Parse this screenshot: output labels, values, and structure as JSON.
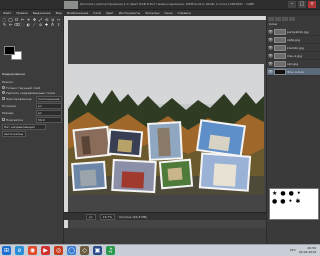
{
  "window": {
    "title": "[Коллаж] (импортирована)-1.0 (Цвет RGB 8 бит гамма-коррекция, GIMP built-in sRGB, 4 слоя) 1280x847 – GIMP",
    "buttons": [
      "–",
      "□",
      "×"
    ]
  },
  "menu": [
    "Файл",
    "Правка",
    "Выделение",
    "Вид",
    "Изображение",
    "Слой",
    "Цвет",
    "Инструменты",
    "Фильтры",
    "Окна",
    "Справка"
  ],
  "toolbox": {
    "tool_glyphs": [
      "⬚",
      "◯",
      "ⵔ",
      "✂",
      "⌖",
      "✥",
      "⤢",
      "⟲",
      "⇲",
      "⇿",
      "✎",
      "✏",
      "⌫",
      "⬛",
      "◐",
      "☄",
      "⊘",
      "✚",
      "A",
      "⇧"
    ],
    "options_title": "Кадрирование",
    "mode_label": "Режим:",
    "radio": [
      "Только текущий слой",
      "Удалить кадрированные точки"
    ],
    "fixed_label": "Фиксированные",
    "fixed_value": "Соотношение",
    "fields": [
      {
        "label": "Позиция:",
        "value": "px"
      },
      {
        "label": "Размер:",
        "value": "px"
      }
    ],
    "highlight_label": "Подсветка",
    "highlight_value": "50.0",
    "guides_label": "Нет направляющих",
    "autoshrink_label": "Автосжатие"
  },
  "canvas": {
    "zoom": "px",
    "zoom_pct": "16.7%",
    "status": "Коллаж (64.8 МБ)"
  },
  "dock": {
    "panel_title": "Слои",
    "layers": [
      {
        "name": "pamyatnik.jpg",
        "visible": true,
        "active": false
      },
      {
        "name": "хрбр.jpg",
        "visible": true,
        "active": false
      },
      {
        "name": "kremlin.jpg",
        "visible": true,
        "active": false
      },
      {
        "name": "msu-1.jpg",
        "visible": true,
        "active": false
      },
      {
        "name": "хрп.jpg",
        "visible": true,
        "active": false
      },
      {
        "name": "Фон копия",
        "visible": true,
        "active": true
      }
    ],
    "eye_glyph": "👁"
  },
  "taskbar": {
    "icons": [
      "⊞",
      "e",
      "◉",
      "▶",
      "◎",
      "◯",
      "◇",
      "▣",
      "♫"
    ],
    "tray_lang": "РУС",
    "time": "20:50",
    "date": "04.04.2019"
  }
}
